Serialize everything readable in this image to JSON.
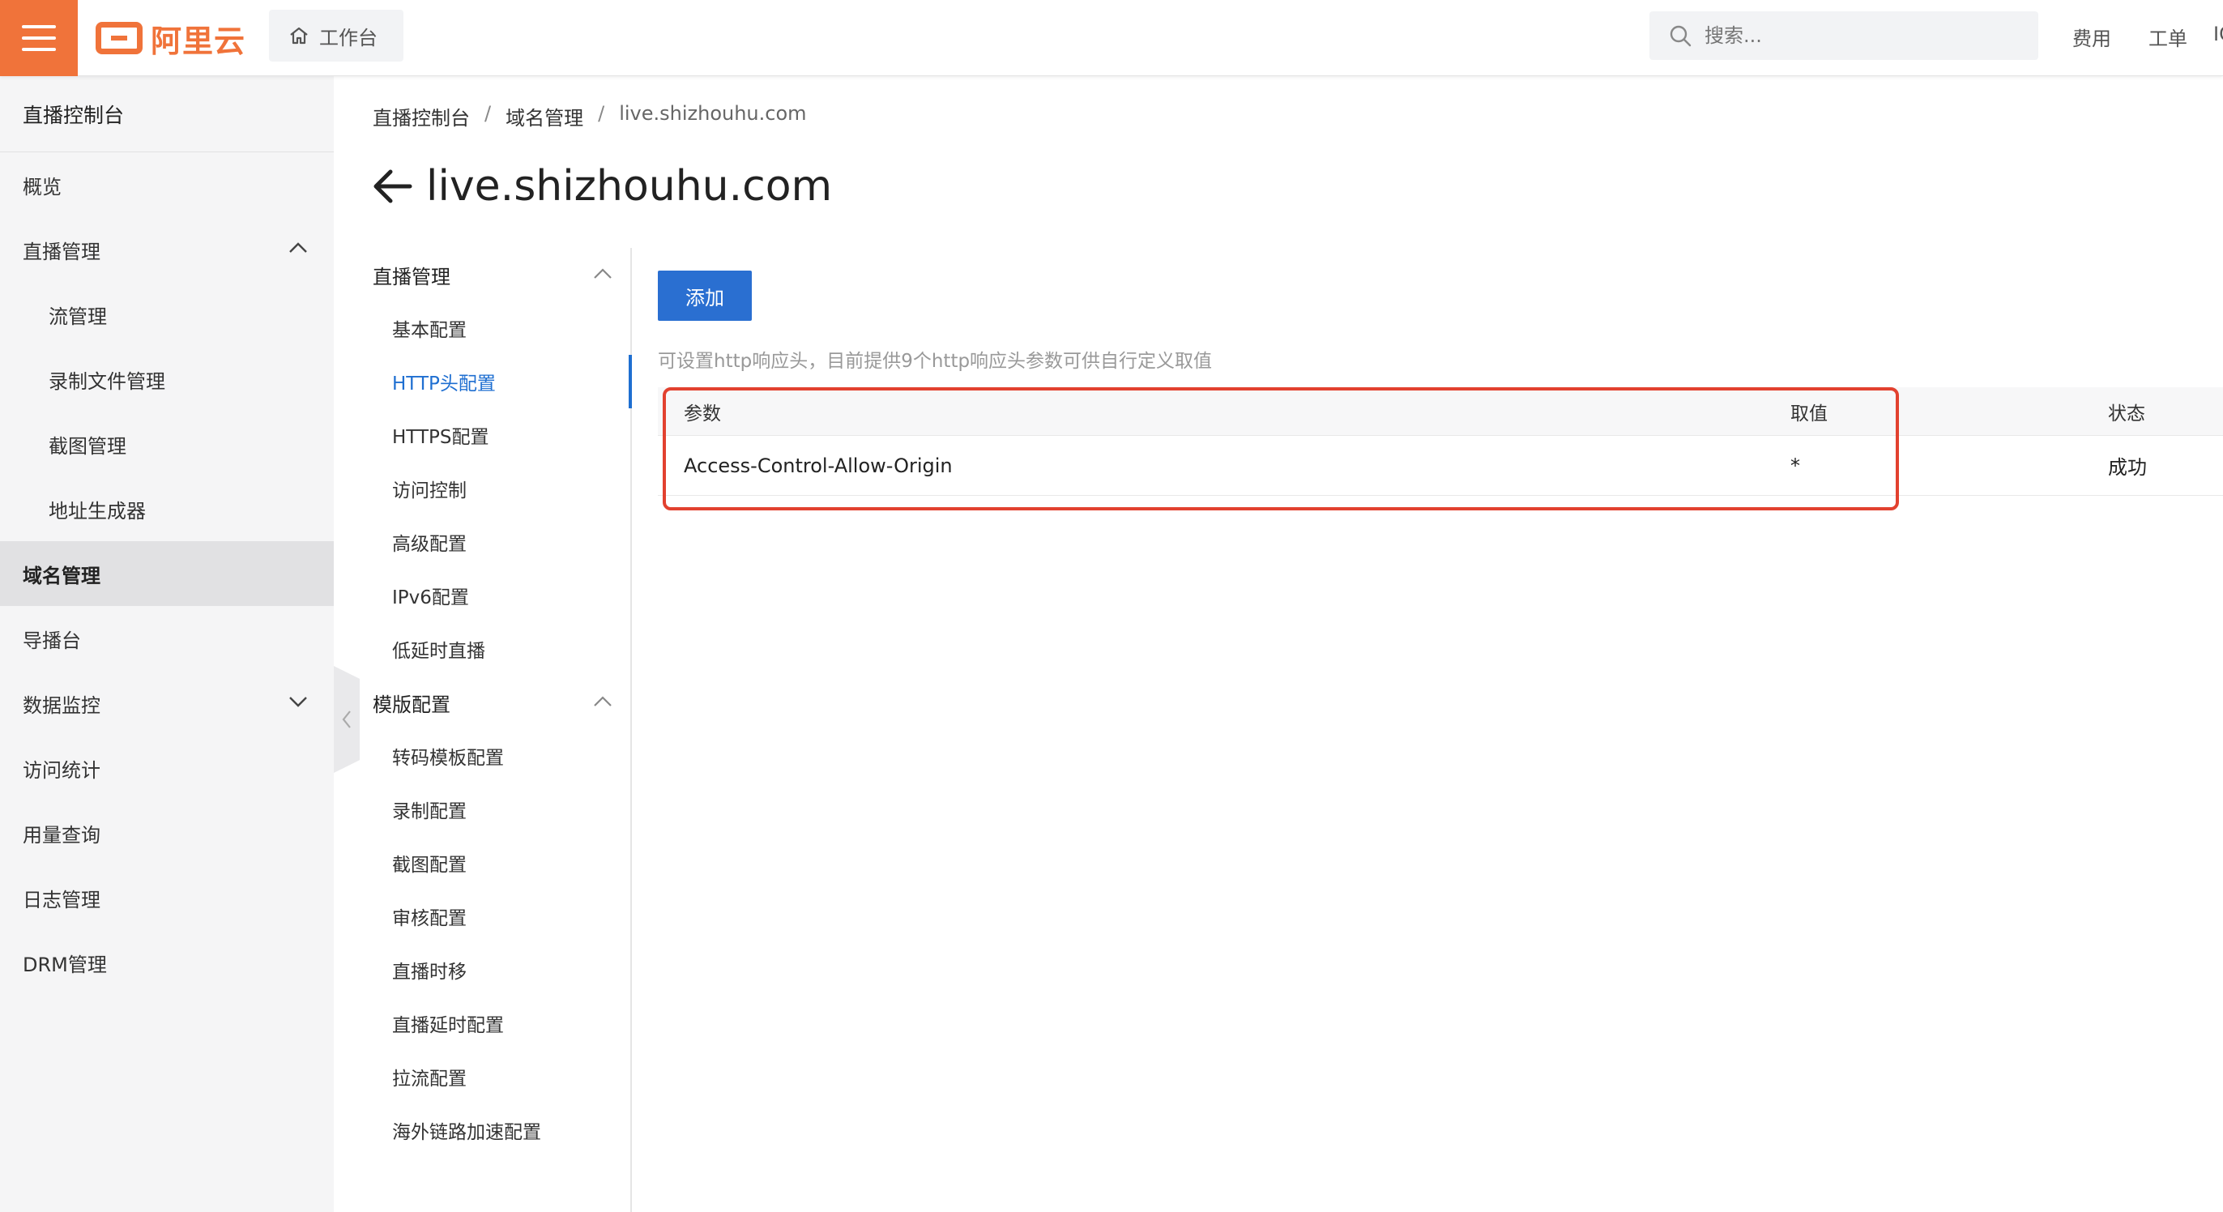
{
  "topbar": {
    "logo_text": "阿里云",
    "workbench_label": "工作台",
    "search_placeholder": "搜索...",
    "links": [
      "费用",
      "工单",
      "IC"
    ]
  },
  "sidebar": {
    "title": "直播控制台",
    "items": [
      {
        "label": "概览"
      },
      {
        "label": "直播管理",
        "expanded": true
      },
      {
        "label": "流管理"
      },
      {
        "label": "录制文件管理"
      },
      {
        "label": "截图管理"
      },
      {
        "label": "地址生成器"
      },
      {
        "label": "域名管理",
        "active": true
      },
      {
        "label": "导播台"
      },
      {
        "label": "数据监控",
        "expanded": false
      },
      {
        "label": "访问统计"
      },
      {
        "label": "用量查询"
      },
      {
        "label": "日志管理"
      },
      {
        "label": "DRM管理"
      }
    ]
  },
  "breadcrumb": [
    "直播控制台",
    "域名管理",
    "live.shizhouhu.com"
  ],
  "page": {
    "title": "live.shizhouhu.com"
  },
  "subnav": {
    "groups": [
      {
        "label": "直播管理",
        "items": [
          "基本配置",
          "HTTP头配置",
          "HTTPS配置",
          "访问控制",
          "高级配置",
          "IPv6配置",
          "低延时直播"
        ]
      },
      {
        "label": "模版配置",
        "items": [
          "转码模板配置",
          "录制配置",
          "截图配置",
          "审核配置",
          "直播时移",
          "直播延时配置",
          "拉流配置",
          "海外链路加速配置"
        ]
      }
    ],
    "active": "HTTP头配置"
  },
  "content": {
    "add_button": "添加",
    "hint": "可设置http响应头，目前提供9个http响应头参数可供自行定义取值",
    "table": {
      "headers": [
        "参数",
        "取值",
        "状态"
      ],
      "rows": [
        [
          "Access-Control-Allow-Origin",
          "*",
          "成功"
        ]
      ]
    }
  },
  "colors": {
    "brand_orange": "#f0733a",
    "accent_blue": "#2a6fd1",
    "highlight_red": "#e2412f"
  }
}
